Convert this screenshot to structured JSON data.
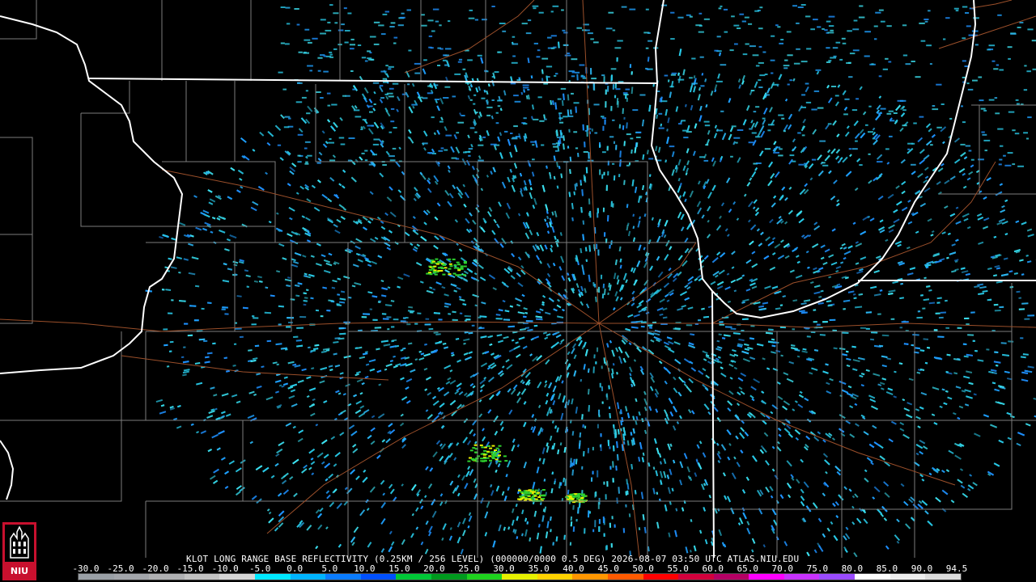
{
  "product_title": "KLOT LONG RANGE BASE REFLECTIVITY (0.25KM / 256 LEVEL) (000000/0000 0.5 DEG) 2026-08-07 03:50 UTC  ATLAS.NIU.EDU",
  "colorbar": {
    "tick_labels": [
      "-30.0",
      "-25.0",
      "-20.0",
      "-15.0",
      "-10.0",
      "-5.0",
      "0.0",
      "5.0",
      "10.0",
      "15.0",
      "20.0",
      "25.0",
      "30.0",
      "35.0",
      "40.0",
      "45.0",
      "50.0",
      "55.0",
      "60.0",
      "65.0",
      "70.0",
      "75.0",
      "80.0",
      "85.0",
      "90.0",
      "94.5"
    ],
    "colors": [
      "#9aa0a6",
      "#a3a6ab",
      "#b0b1b3",
      "#c3c3c3",
      "#d6d6d6",
      "#00e8ff",
      "#00b4ff",
      "#0a7cff",
      "#0050ff",
      "#00c837",
      "#009a1e",
      "#1ed21e",
      "#e6f000",
      "#ffd200",
      "#ff9600",
      "#ff5a00",
      "#ff0000",
      "#d2003c",
      "#b40064",
      "#ff00ff",
      "#c832ff",
      "#9a4bff",
      "#ffffff",
      "#eeeeee",
      "#dddddd"
    ]
  },
  "logo": {
    "text": "NIU",
    "name": "niu-logo"
  },
  "map": {
    "radar_site": "KLOT",
    "colors": {
      "state_lines": "#ffffff",
      "county_lines": "#8a8a8a",
      "roads": "#a0522d",
      "echo_light": "#28c8e6",
      "echo_mid": "#1e90ff",
      "echo_green": "#2ed12e",
      "echo_yellow": "#e6f000"
    }
  }
}
